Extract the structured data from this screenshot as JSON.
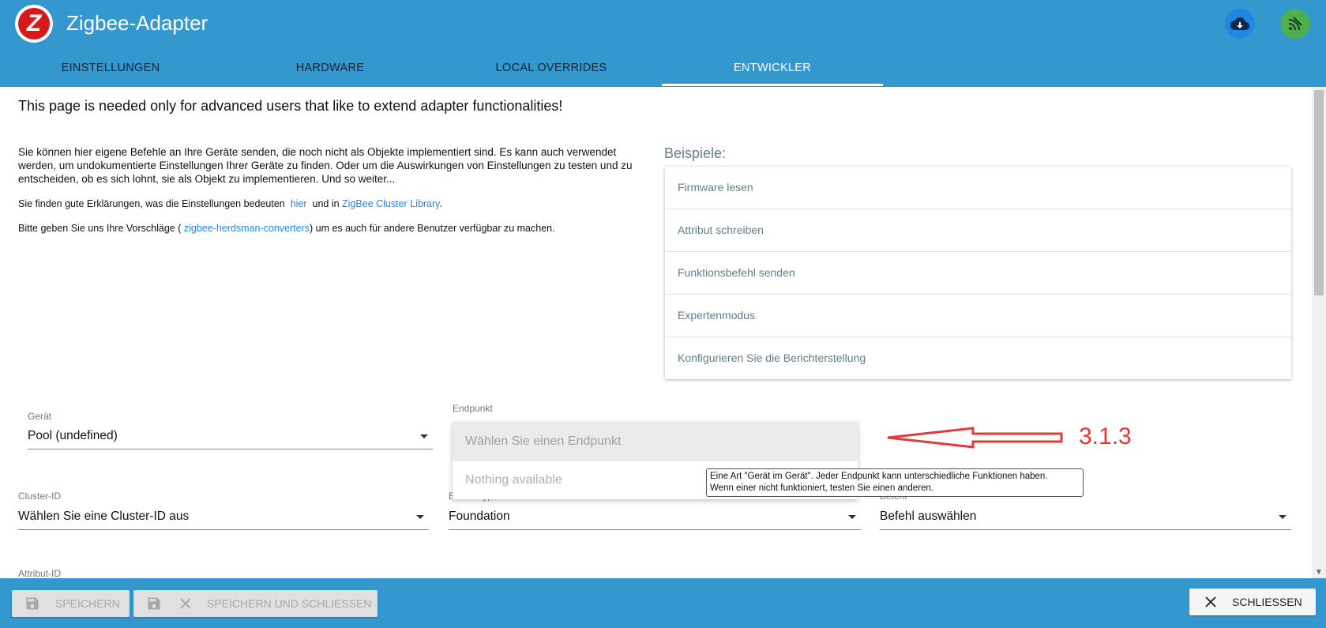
{
  "app": {
    "title": "Zigbee-Adapter"
  },
  "tabs": [
    {
      "label": "EINSTELLUNGEN"
    },
    {
      "label": "HARDWARE"
    },
    {
      "label": "LOCAL OVERRIDES"
    },
    {
      "label": "ENTWICKLER"
    }
  ],
  "active_tab": "ENTWICKLER",
  "header_icons": [
    "cloud-download-icon",
    "zigbee-signal-icon"
  ],
  "colors": {
    "header": "#3498cf",
    "accent": "#1e88e5",
    "logo": "#d7191c",
    "annotation": "#e53935"
  },
  "intro": "This page is needed only for advanced users that like to extend adapter functionalities!",
  "description": "Sie können hier eigene Befehle an Ihre Geräte senden, die noch nicht als Objekte implementiert sind. Es kann auch verwendet werden, um undokumentierte Einstellungen Ihrer Geräte zu finden. Oder um die Auswirkungen von Einstellungen zu testen und zu entscheiden, ob es sich lohnt, sie als Objekt zu implementieren. Und so weiter...",
  "explanation": {
    "prefix": "Sie finden gute Erklärungen, was die Einstellungen bedeuten",
    "link1": "hier",
    "middle": "und in",
    "link2": "ZigBee Cluster Library",
    "suffix": "."
  },
  "suggestion": {
    "prefix": "Bitte geben Sie uns Ihre Vorschläge (",
    "link": "zigbee-herdsman-converters",
    "suffix": ") um es auch für andere Benutzer verfügbar zu machen."
  },
  "examples": {
    "title": "Beispiele:",
    "items": [
      "Firmware lesen",
      "Attribut schreiben",
      "Funktionsbefehl senden",
      "Expertenmodus",
      "Konfigurieren Sie die Berichterstellung"
    ]
  },
  "fields": {
    "device": {
      "label": "Gerät",
      "value": "Pool (undefined)"
    },
    "endpoint": {
      "label": "Endpunkt",
      "placeholder": "Wählen Sie einen Endpunkt",
      "empty": "Nothing available",
      "tooltip_line1": "Eine Art \"Gerät im Gerät\". Jeder Endpunkt kann unterschiedliche Funktionen haben.",
      "tooltip_line2": "Wenn einer nicht funktioniert, testen Sie einen anderen."
    },
    "cluster": {
      "label": "Cluster-ID",
      "value": "Wählen Sie eine Cluster-ID aus"
    },
    "command_type": {
      "label": "Befehlstyp",
      "value": "Foundation"
    },
    "command": {
      "label": "Befehl",
      "value": "Befehl auswählen"
    },
    "attribute": {
      "label": "Attribut-ID"
    }
  },
  "annotation": {
    "label": "3.1.3"
  },
  "footer": {
    "save": "SPEICHERN",
    "save_close": "SPEICHERN UND SCHLIESSEN",
    "close": "SCHLIESSEN"
  }
}
